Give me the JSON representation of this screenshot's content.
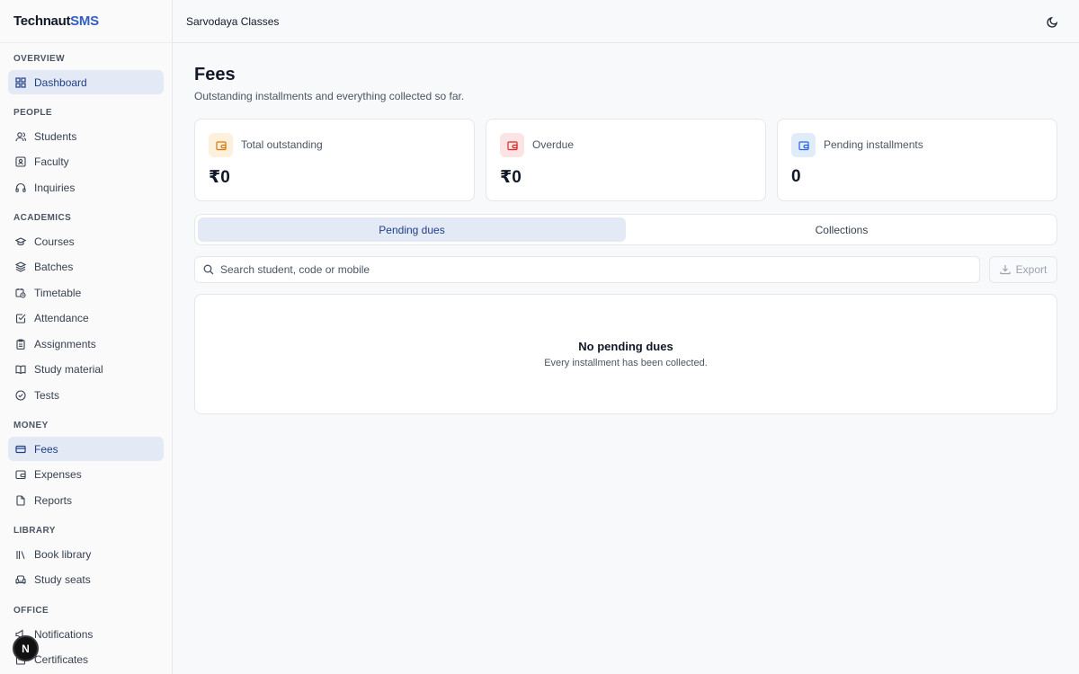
{
  "brand": {
    "name_part1": "Technaut",
    "name_part2": "SMS"
  },
  "topbar": {
    "org_name": "Sarvodaya Classes",
    "theme_icon": "moon-icon"
  },
  "sidebar": {
    "sections": {
      "overview": "OVERVIEW",
      "people": "PEOPLE",
      "academics": "ACADEMICS",
      "money": "MONEY",
      "library": "LIBRARY",
      "office": "OFFICE"
    },
    "items": {
      "dashboard": "Dashboard",
      "students": "Students",
      "faculty": "Faculty",
      "inquiries": "Inquiries",
      "courses": "Courses",
      "batches": "Batches",
      "timetable": "Timetable",
      "attendance": "Attendance",
      "assignments": "Assignments",
      "study_material": "Study material",
      "tests": "Tests",
      "fees": "Fees",
      "expenses": "Expenses",
      "reports": "Reports",
      "book_library": "Book library",
      "study_seats": "Study seats",
      "notifications": "Notifications",
      "certificates": "Certificates"
    }
  },
  "main": {
    "title": "Fees",
    "subtitle": "Outstanding installments and everything collected so far.",
    "cards": [
      {
        "label": "Total outstanding",
        "value": "₹0",
        "color": "#f59e0b"
      },
      {
        "label": "Overdue",
        "value": "₹0",
        "color": "#ef4444"
      },
      {
        "label": "Pending installments",
        "value": "0",
        "color": "#3b82f6"
      }
    ],
    "tabs": {
      "pending": "Pending dues",
      "collections": "Collections"
    },
    "search": {
      "placeholder": "Search student, code or mobile",
      "value": ""
    },
    "export_label": "Export",
    "empty": {
      "title": "No pending dues",
      "description": "Every installment has been collected."
    }
  },
  "fab": {
    "label": "N"
  }
}
